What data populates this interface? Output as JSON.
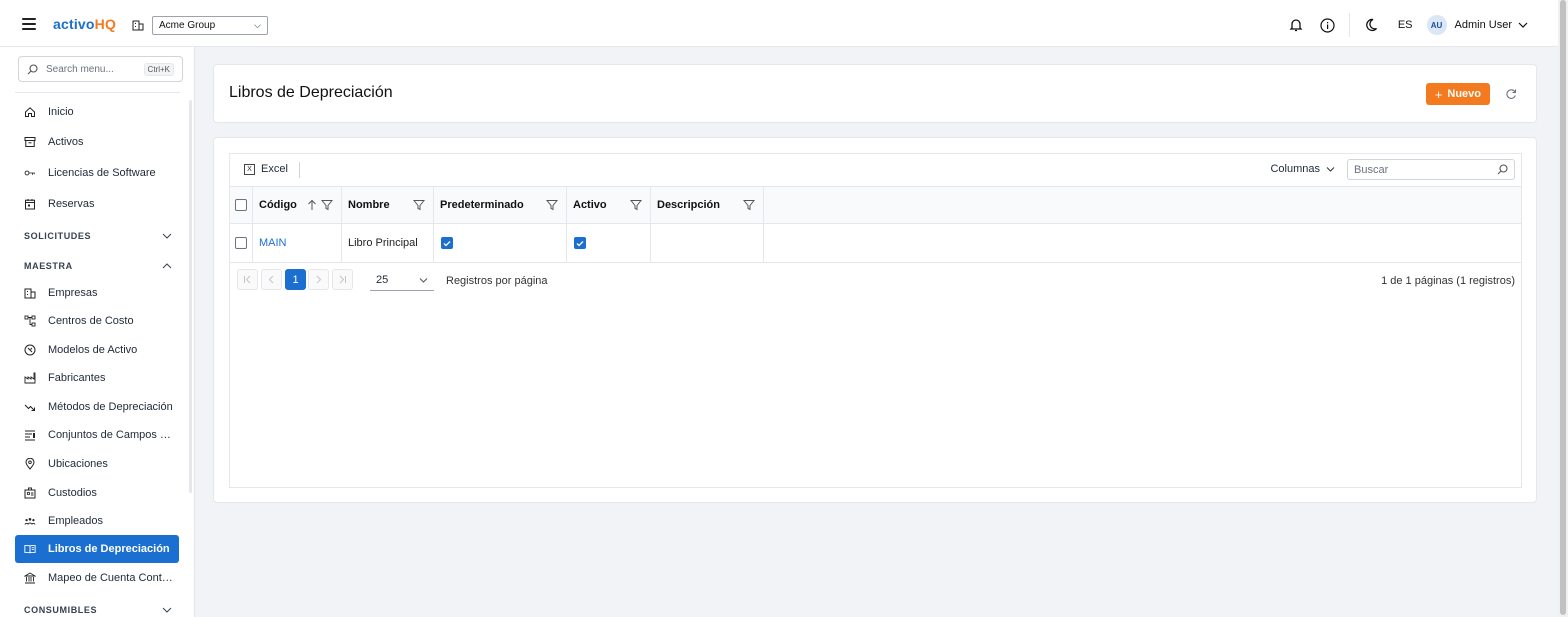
{
  "app": {
    "logo_main": "activo",
    "logo_accent": "HQ",
    "org_selected": "Acme Group",
    "language": "ES",
    "user_initials": "AU",
    "user_name": "Admin User"
  },
  "sidebar": {
    "search_placeholder": "Search menu...",
    "search_shortcut": "Ctrl+K",
    "items": [
      {
        "label": "Inicio",
        "icon": "home-icon"
      },
      {
        "label": "Activos",
        "icon": "archive-icon"
      },
      {
        "label": "Licencias de Software",
        "icon": "key-icon"
      },
      {
        "label": "Reservas",
        "icon": "calendar-icon"
      }
    ],
    "sections": [
      {
        "label": "SOLICITUDES",
        "expanded": false
      },
      {
        "label": "MAESTRA",
        "expanded": true
      },
      {
        "label": "CONSUMIBLES",
        "expanded": false
      }
    ],
    "maestra_items": [
      {
        "label": "Empresas",
        "icon": "building-icon"
      },
      {
        "label": "Centros de Costo",
        "icon": "hierarchy-icon"
      },
      {
        "label": "Modelos de Activo",
        "icon": "model-icon"
      },
      {
        "label": "Fabricantes",
        "icon": "factory-icon"
      },
      {
        "label": "Métodos de Depreciación",
        "icon": "trend-down-icon"
      },
      {
        "label": "Conjuntos de Campos P...",
        "icon": "form-fields-icon"
      },
      {
        "label": "Ubicaciones",
        "icon": "map-pin-icon"
      },
      {
        "label": "Custodios",
        "icon": "id-badge-icon"
      },
      {
        "label": "Empleados",
        "icon": "users-icon"
      },
      {
        "label": "Libros de Depreciación",
        "icon": "book-open-icon",
        "active": true
      },
      {
        "label": "Mapeo de Cuenta Conta...",
        "icon": "bank-icon"
      }
    ]
  },
  "page": {
    "title": "Libros de Depreciación",
    "new_button": "Nuevo"
  },
  "grid": {
    "excel_label": "Excel",
    "columns_label": "Columnas",
    "search_placeholder": "Buscar",
    "headers": {
      "codigo": "Código",
      "nombre": "Nombre",
      "predeterminado": "Predeterminado",
      "activo": "Activo",
      "descripcion": "Descripción"
    },
    "rows": [
      {
        "codigo": "MAIN",
        "nombre": "Libro Principal",
        "predeterminado": true,
        "activo": true,
        "descripcion": ""
      }
    ],
    "pager": {
      "current_page": "1",
      "page_size": "25",
      "per_page_label": "Registros por página",
      "info": "1 de 1 páginas (1 registros)"
    }
  },
  "colors": {
    "primary": "#1b6fd0",
    "accent": "#f47a20"
  }
}
